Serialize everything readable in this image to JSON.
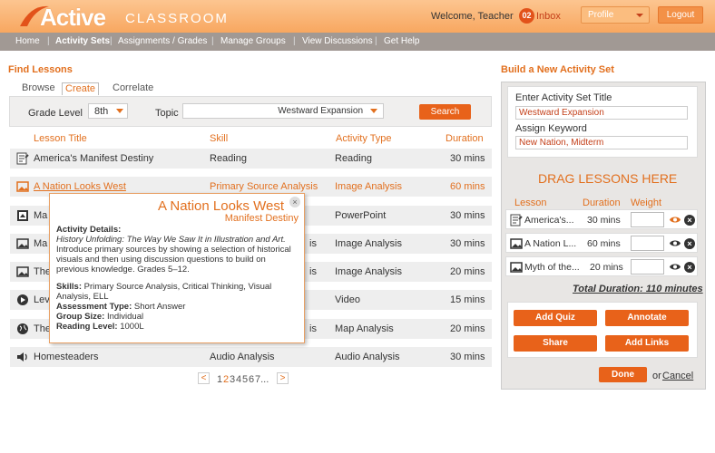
{
  "header": {
    "logo_active": "Active",
    "logo_classroom": "CLASSROOM",
    "welcome": "Welcome, Teacher",
    "inbox_count": "02",
    "inbox_label": "Inbox",
    "profile_label": "Profile",
    "logout_label": "Logout"
  },
  "nav": [
    "Home",
    "Activity Sets",
    "Assignments / Grades",
    "Manage Groups",
    "View Discussions",
    "Get Help"
  ],
  "find": {
    "title": "Find Lessons",
    "tabs": [
      "Browse",
      "Create",
      "Correlate"
    ],
    "active_tab": "Create",
    "grade_label": "Grade Level",
    "grade_value": "8th",
    "topic_label": "Topic",
    "topic_value": "Westward Expansion",
    "search_label": "Search",
    "columns": [
      "Lesson Title",
      "Skill",
      "Activity Type",
      "Duration"
    ],
    "rows": [
      {
        "icon": "document-icon",
        "title": "America's Manifest Destiny",
        "skill": "Reading",
        "type": "Reading",
        "duration": "30 mins"
      },
      {
        "icon": "image-icon",
        "title": "A Nation Looks West",
        "skill": "Primary Source Analysis",
        "type": "Image Analysis",
        "duration": "60 mins"
      },
      {
        "icon": "powerpoint-icon",
        "title": "Ma",
        "skill": "",
        "type": "PowerPoint",
        "duration": "30 mins"
      },
      {
        "icon": "image-icon",
        "title": "Ma",
        "skill": "is",
        "type": "Image Analysis",
        "duration": "30 mins"
      },
      {
        "icon": "image-icon",
        "title": "The",
        "skill": "is",
        "type": "Image Analysis",
        "duration": "20 mins"
      },
      {
        "icon": "video-icon",
        "title": "Lev",
        "skill": "",
        "type": "Video",
        "duration": "15 mins"
      },
      {
        "icon": "globe-icon",
        "title": "The",
        "skill": "is",
        "type": "Map Analysis",
        "duration": "20 mins"
      },
      {
        "icon": "audio-icon",
        "title": "Homesteaders",
        "skill": "Audio Analysis",
        "type": "Audio Analysis",
        "duration": "30 mins"
      }
    ],
    "pager": {
      "prev": "<",
      "pages": [
        "1",
        "2",
        "3",
        "4",
        "5",
        "6",
        "7..."
      ],
      "current": "2",
      "next": ">"
    }
  },
  "popup": {
    "title": "A Nation Looks West",
    "subtitle": "Manifest Destiny",
    "details_label": "Activity Details:",
    "details_source": "History Unfolding: The Way We Saw It in Illustration and Art.",
    "details_text": "Introduce primary sources by showing a selection of historical visuals and then using discussion questions to build on previous knowledge. Grades 5–12.",
    "skills_label": "Skills:",
    "skills_value": "Primary Source Analysis, Critical Thinking, Visual Analysis, ELL",
    "assessment_label": "Assessment Type:",
    "assessment_value": "Short Answer",
    "group_label": "Group Size:",
    "group_value": "Individual",
    "reading_label": "Reading Level:",
    "reading_value": "1000L",
    "close": "×"
  },
  "build": {
    "title": "Build a New Activity Set",
    "set_title_label": "Enter Activity Set Title",
    "set_title_value": "Westward Expansion",
    "keyword_label": "Assign Keyword",
    "keyword_value": "New Nation, Midterm",
    "drag_label": "DRAG LESSONS HERE",
    "columns": [
      "Lesson",
      "Duration",
      "Weight"
    ],
    "lessons": [
      {
        "icon": "document-icon",
        "title": "America's...",
        "duration": "30 mins"
      },
      {
        "icon": "image-icon",
        "title": "A Nation L...",
        "duration": "60 mins"
      },
      {
        "icon": "image-icon",
        "title": "Myth of the...",
        "duration": "20 mins"
      }
    ],
    "total_label": "Total Duration: 110 minutes",
    "buttons": [
      "Add Quiz",
      "Annotate",
      "Share",
      "Add Links"
    ],
    "done_label": "Done",
    "or_label": "or",
    "cancel_label": "Cancel"
  },
  "colors": {
    "accent": "#e2701f",
    "button": "#e8621a",
    "header": "#f8a760",
    "nav": "#a19994"
  }
}
